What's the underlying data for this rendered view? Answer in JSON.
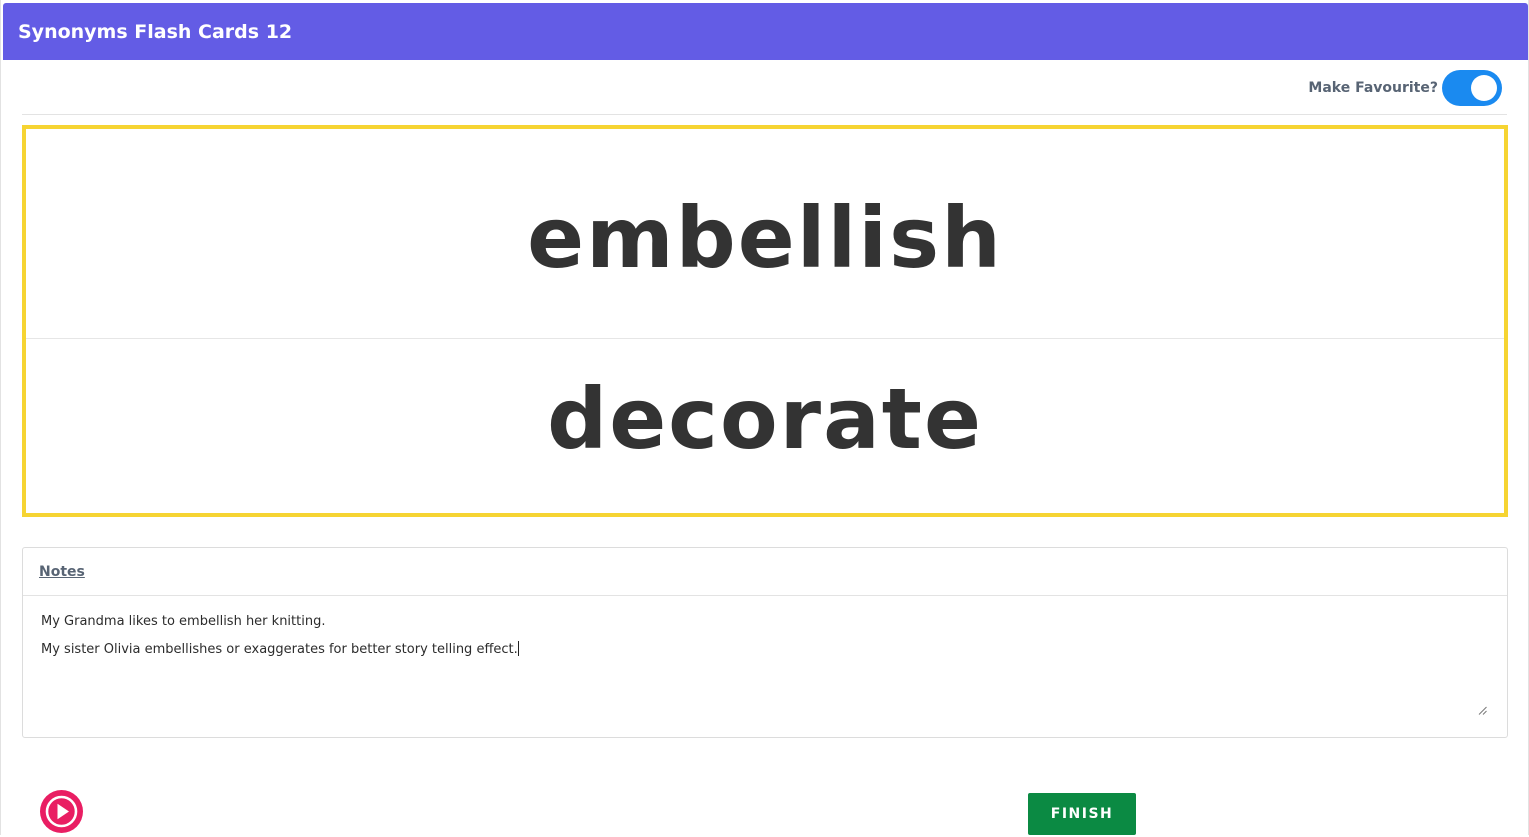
{
  "header": {
    "title": "Synonyms Flash Cards 12"
  },
  "favourite": {
    "label": "Make Favourite?",
    "enabled": true
  },
  "card": {
    "word": "embellish",
    "synonym": "decorate",
    "border_color": "#f6d432"
  },
  "notes": {
    "title": "Notes",
    "lines": [
      "My Grandma likes to embellish her knitting.",
      "My sister Olivia embellishes or exaggerates for better story telling effect."
    ]
  },
  "controls": {
    "finish_label": "FINISH",
    "play_icon": "play-icon"
  },
  "colors": {
    "header": "#635ce5",
    "toggle": "#1a8af0",
    "play": "#e91e63",
    "finish": "#0b8a43"
  }
}
